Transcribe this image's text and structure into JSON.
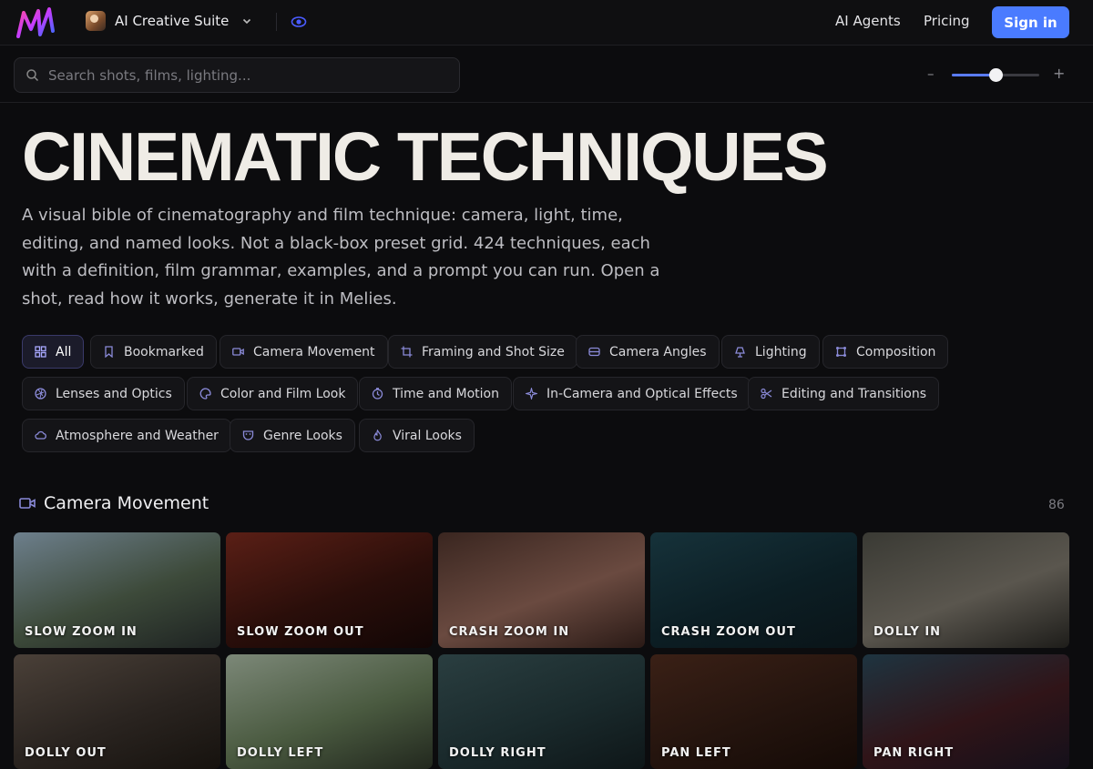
{
  "nav": {
    "suite_label": "AI Creative Suite",
    "links": [
      "AI Agents",
      "Pricing"
    ],
    "signin_label": "Sign in"
  },
  "search": {
    "placeholder": "Search shots, films, lighting...",
    "value": ""
  },
  "zoom": {
    "minus": "–",
    "plus": "+",
    "level": 0.5
  },
  "hero": {
    "title": "CINEMATIC TECHNIQUES",
    "description": "A visual bible of cinematography and film technique: camera, light, time, editing, and named looks. Not a black-box preset grid. 424 techniques, each with a definition, film grammar, examples, and a prompt you can run. Open a shot, read how it works, generate it in Melies."
  },
  "filters": [
    {
      "label": "All",
      "icon": "grid-icon",
      "active": true
    },
    {
      "label": "Bookmarked",
      "icon": "bookmark-icon"
    },
    {
      "label": "Camera Movement",
      "icon": "video-camera-icon"
    },
    {
      "label": "Framing and Shot Size",
      "icon": "crop-icon"
    },
    {
      "label": "Camera Angles",
      "icon": "angle-icon"
    },
    {
      "label": "Lighting",
      "icon": "lamp-icon"
    },
    {
      "label": "Composition",
      "icon": "composition-icon"
    },
    {
      "label": "Lenses and Optics",
      "icon": "aperture-icon"
    },
    {
      "label": "Color and Film Look",
      "icon": "palette-icon"
    },
    {
      "label": "Time and Motion",
      "icon": "timer-icon"
    },
    {
      "label": "In-Camera and Optical Effects",
      "icon": "sparkle-icon"
    },
    {
      "label": "Editing and Transitions",
      "icon": "scissors-icon"
    },
    {
      "label": "Atmosphere and Weather",
      "icon": "cloud-icon"
    },
    {
      "label": "Genre Looks",
      "icon": "mask-icon"
    },
    {
      "label": "Viral Looks",
      "icon": "flame-icon"
    }
  ],
  "section": {
    "title": "Camera Movement",
    "count": "86",
    "icon": "video-camera-icon"
  },
  "cards": [
    {
      "label": "SLOW ZOOM IN",
      "colors": [
        "#6d7f8c",
        "#3d4a3a",
        "#1e2322"
      ]
    },
    {
      "label": "SLOW ZOOM OUT",
      "colors": [
        "#5a1f16",
        "#2a0e0a",
        "#120605"
      ]
    },
    {
      "label": "CRASH ZOOM IN",
      "colors": [
        "#3a2620",
        "#6a4a40",
        "#2a1a16"
      ]
    },
    {
      "label": "CRASH ZOOM OUT",
      "colors": [
        "#16323a",
        "#0c1e24",
        "#0a1418"
      ]
    },
    {
      "label": "DOLLY IN",
      "colors": [
        "#3a3a34",
        "#5a564e",
        "#1e1d1a"
      ]
    },
    {
      "label": "DOLLY OUT",
      "colors": [
        "#4a4038",
        "#2a2420",
        "#16120e"
      ]
    },
    {
      "label": "DOLLY LEFT",
      "colors": [
        "#7c8878",
        "#4a5a40",
        "#22281e"
      ]
    },
    {
      "label": "DOLLY RIGHT",
      "colors": [
        "#2a3e40",
        "#1a2a2c",
        "#0e1618"
      ]
    },
    {
      "label": "PAN LEFT",
      "colors": [
        "#3a2016",
        "#24140e",
        "#140a06"
      ]
    },
    {
      "label": "PAN RIGHT",
      "colors": [
        "#1e3440",
        "#301418",
        "#14101a"
      ]
    }
  ],
  "colors": {
    "accent": "#4a7bff",
    "background": "#0c0c0e"
  }
}
